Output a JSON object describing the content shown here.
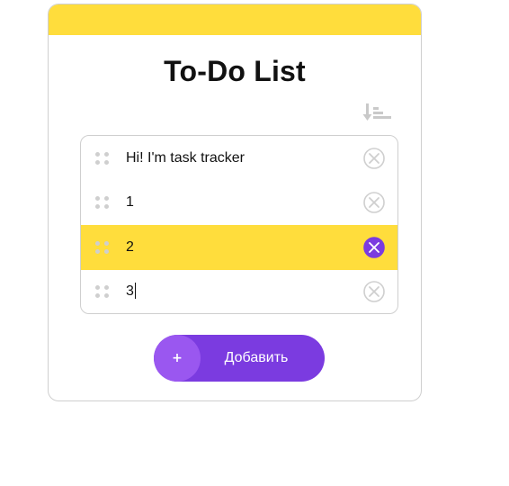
{
  "app": {
    "title": "To-Do List",
    "accent_color": "#ffdd3c",
    "primary_color": "#7b3be0"
  },
  "toolbar": {
    "sort_icon": "sort-order-icon"
  },
  "tasks": [
    {
      "text": "Hi! I'm task tracker",
      "active": false,
      "editing": false
    },
    {
      "text": "1",
      "active": false,
      "editing": false
    },
    {
      "text": "2",
      "active": true,
      "editing": false
    },
    {
      "text": "3",
      "active": false,
      "editing": true
    }
  ],
  "icons": {
    "drag": "drag-handle-icon",
    "remove": "close-circle-icon"
  },
  "add_button": {
    "plus_label": "+",
    "label": "Добавить"
  }
}
